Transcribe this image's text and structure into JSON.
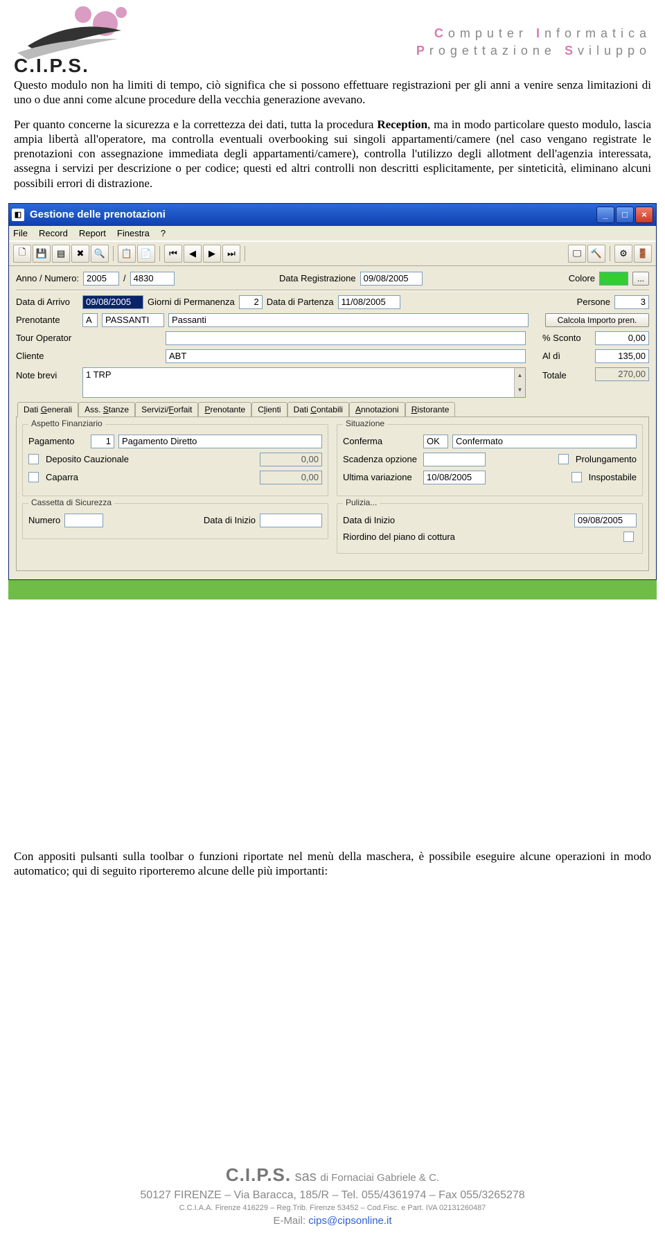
{
  "header": {
    "brand_C": "C",
    "brand_I": "I",
    "brand_P": "P",
    "brand_S": "S",
    "tagline1_a": "C",
    "tagline1_b": "omputer ",
    "tagline1_c": "I",
    "tagline1_d": "nformatica",
    "tagline2_a": "P",
    "tagline2_b": "rogettazione ",
    "tagline2_c": "S",
    "tagline2_d": "viluppo"
  },
  "para1": "Questo modulo non ha limiti di tempo, ciò significa che si possono effettuare registrazioni per gli anni a venire senza limitazioni di uno o due anni come alcune procedure della vecchia generazione avevano.",
  "para2a": "Per quanto concerne la sicurezza e la correttezza dei dati, tutta la procedura ",
  "para2b": "Reception",
  "para2c": ", ma in modo particolare questo modulo, lascia ampia libertà all'operatore, ma controlla eventuali overbooking sui singoli appartamenti/camere (nel caso vengano registrate le prenotazioni con assegnazione immediata degli appartamenti/camere), controlla l'utilizzo degli allotment dell'agenzia interessata, assegna i servizi per descrizione o per codice; questi ed altri controlli non descritti esplicitamente, per sinteticità, eliminano alcuni possibili errori di distrazione.",
  "para3": "Con appositi pulsanti sulla toolbar o funzioni riportate nel menù della maschera, è possibile eseguire alcune operazioni in modo automatico; qui di seguito riporteremo alcune delle più importanti:",
  "window": {
    "title": "Gestione delle prenotazioni",
    "menus": [
      "File",
      "Record",
      "Report",
      "Finestra",
      "?"
    ],
    "form": {
      "anno_label": "Anno / Numero:",
      "anno": "2005",
      "numero": "4830",
      "data_reg_label": "Data Registrazione",
      "data_reg": "09/08/2005",
      "colore_label": "Colore",
      "colore_btn": "...",
      "arrivo_label": "Data di Arrivo",
      "arrivo": "09/08/2005",
      "giorni_label": "Giorni di Permanenza",
      "giorni": "2",
      "partenza_label": "Data di Partenza",
      "partenza": "11/08/2005",
      "persone_label": "Persone",
      "persone": "3",
      "prenotante_label": "Prenotante",
      "pren_code": "A",
      "pren_name": "PASSANTI",
      "pren_desc": "Passanti",
      "calc_btn": "Calcola Importo pren.",
      "tour_label": "Tour Operator",
      "sconto_label": "% Sconto",
      "sconto": "0,00",
      "cliente_label": "Cliente",
      "cliente_val": "ABT",
      "aldi_label": "Al dì",
      "aldi": "135,00",
      "note_label": "Note brevi",
      "note_val": "1 TRP",
      "totale_label": "Totale",
      "totale": "270,00"
    },
    "tabs": [
      "Dati Generali",
      "Ass. Stanze",
      "Servizi/Forfait",
      "Prenotante",
      "Clienti",
      "Dati Contabili",
      "Annotazioni",
      "Ristorante"
    ],
    "tabchars": [
      "G",
      "S",
      "F",
      "P",
      "l",
      "C",
      "A",
      "R"
    ],
    "panel": {
      "fs_fin": "Aspetto Finanziario",
      "pagamento_label": "Pagamento",
      "pagamento_code": "1",
      "pagamento_desc": "Pagamento Diretto",
      "deposito_label": "Deposito Cauzionale",
      "deposito_val": "0,00",
      "caparra_label": "Caparra",
      "caparra_val": "0,00",
      "fs_sit": "Situazione",
      "conferma_label": "Conferma",
      "conferma_code": "OK",
      "conferma_desc": "Confermato",
      "scadenza_label": "Scadenza opzione",
      "ultima_label": "Ultima variazione",
      "ultima_val": "10/08/2005",
      "prolung_label": "Prolungamento",
      "inspost_label": "Inspostabile",
      "fs_cass": "Cassetta di Sicurezza",
      "cass_num_label": "Numero",
      "cass_data_label": "Data di Inizio",
      "fs_pul": "Pulizia...",
      "pul_data_label": "Data di Inizio",
      "pul_data_val": "09/08/2005",
      "pul_riord_label": "Riordino del piano di cottura"
    }
  },
  "footer": {
    "l1a": "C.I.P.S.",
    "l1b": " sas ",
    "l1c": "di Fornaciai Gabriele & C.",
    "l2": "50127 FIRENZE – Via Baracca, 185/R – Tel. 055/4361974 – Fax 055/3265278",
    "l3": "C.C.I.A.A. Firenze 416229 – Reg.Trib. Firenze 53452 – Cod.Fisc. e Part. IVA 02131260487",
    "l4a": "E-Mail: ",
    "l4b": "cips@cipsonline.it"
  }
}
